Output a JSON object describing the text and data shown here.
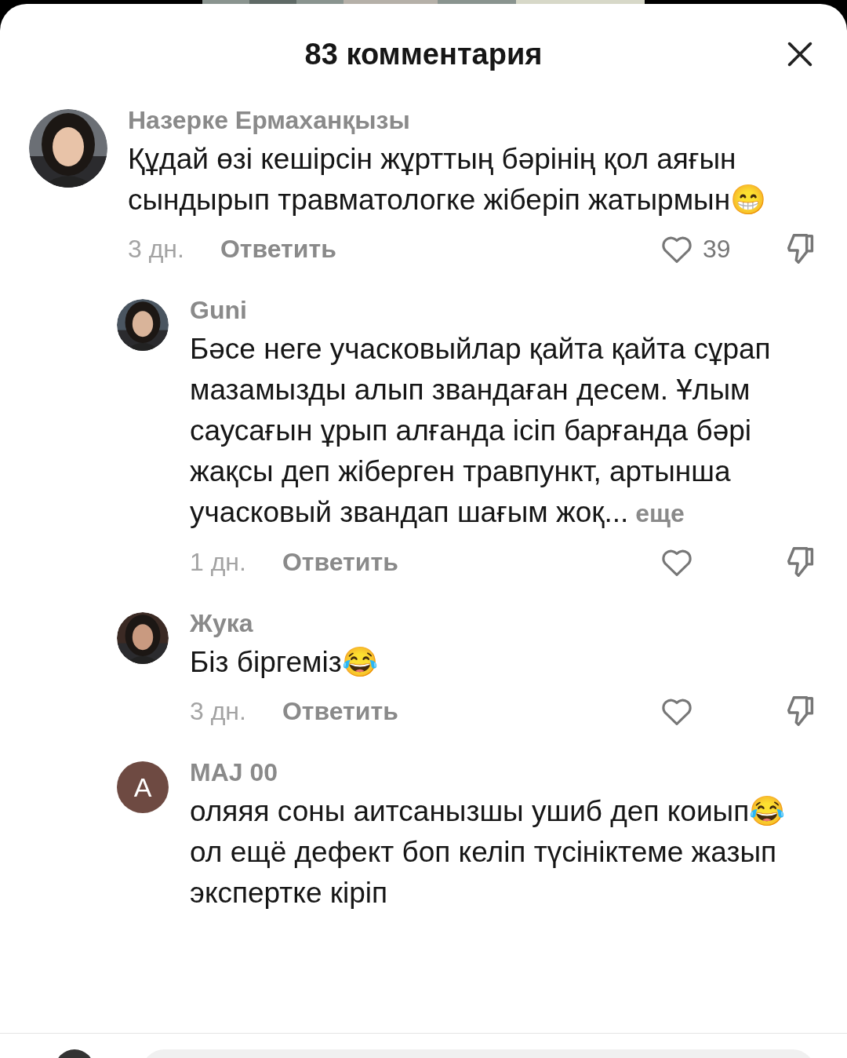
{
  "header": {
    "title": "83 комментария"
  },
  "comments": [
    {
      "author": "Назерке Ермаханқызы",
      "text": "Құдай өзі кешірсін жұрттың бәрінің қол аяғын сындырып травматологке жіберіп жатырмын😁",
      "time": "3 дн.",
      "reply": "Ответить",
      "likes": "39",
      "children": [
        {
          "author": "Guni",
          "text": "Бәсе неге учасковыйлар қайта қайта сұрап мазамызды алып звандаған десем. Ұлым саусағын ұрып алғанда ісіп барғанда бәрі жақсы деп жіберген травпункт, артынша учасковый звандап шағым жоқ...",
          "more": "еще",
          "time": "1 дн.",
          "reply": "Ответить"
        },
        {
          "author": "Жука",
          "text": "Біз біргеміз😂",
          "time": "3 дн.",
          "reply": "Ответить"
        },
        {
          "author": "MAJ 00",
          "avatar": {
            "kind": "letter",
            "letter": "A"
          },
          "text": "оляяя соны аитсанызшы ушиб деп коиып😂 ол ещё дефект боп келіп түсініктеме жазып экспертке кіріп"
        }
      ]
    }
  ]
}
